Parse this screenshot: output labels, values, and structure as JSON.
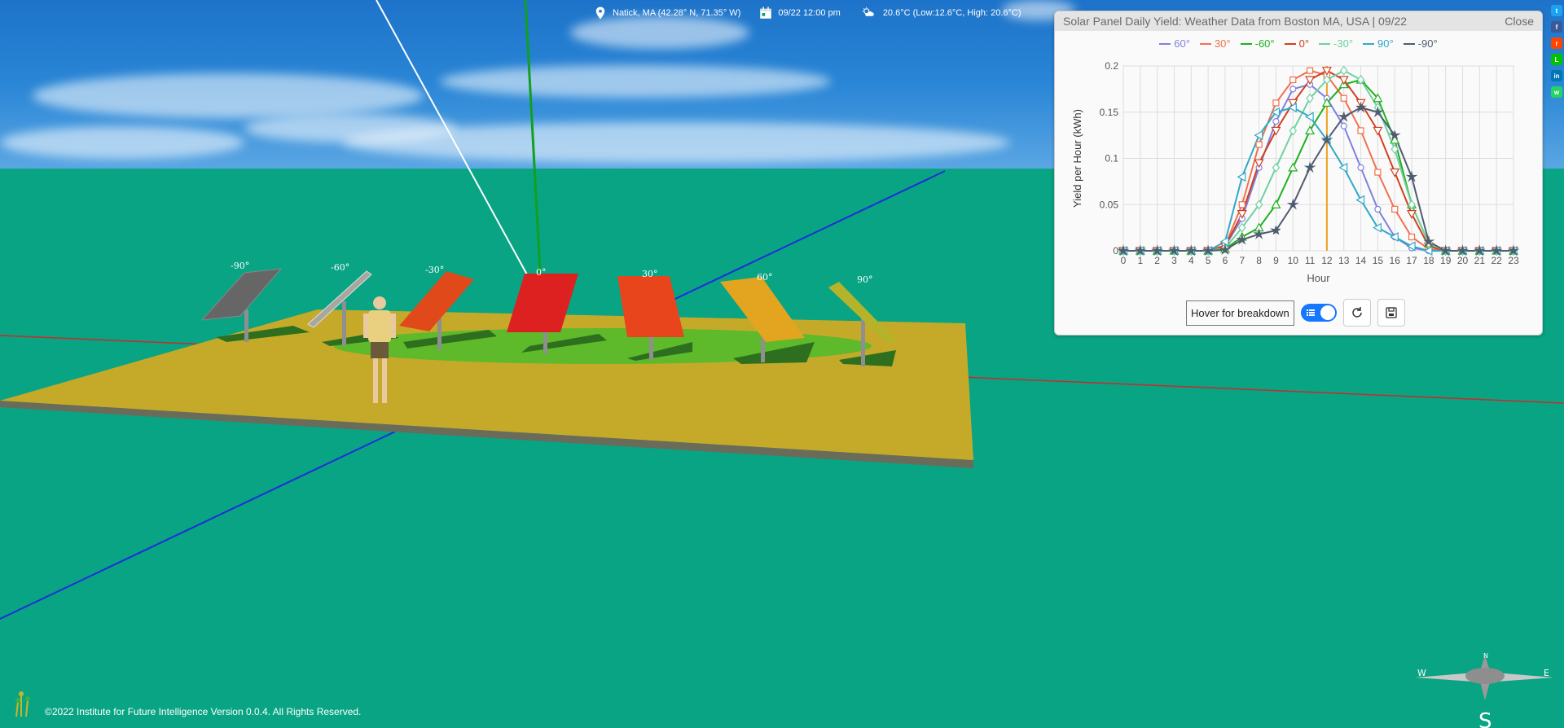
{
  "infobar": {
    "location": "Natick, MA (42.28° N, 71.35° W)",
    "datetime": "09/22 12:00 pm",
    "weather": "20.6°C (Low:12.6°C, High: 20.6°C)"
  },
  "scene": {
    "panel_labels": [
      "-90°",
      "-60°",
      "-30°",
      "0°",
      "30°",
      "60°",
      "90°"
    ]
  },
  "chart_window": {
    "title": "Solar Panel Daily Yield: Weather Data from Boston MA, USA | 09/22",
    "close_label": "Close",
    "hover_label": "Hover for breakdown"
  },
  "chart_data": {
    "type": "line",
    "xlabel": "Hour",
    "ylabel": "Yield per Hour (kWh)",
    "x": [
      0,
      1,
      2,
      3,
      4,
      5,
      6,
      7,
      8,
      9,
      10,
      11,
      12,
      13,
      14,
      15,
      16,
      17,
      18,
      19,
      20,
      21,
      22,
      23
    ],
    "ylim": [
      0,
      0.2
    ],
    "yticks": [
      "0",
      "0.05",
      "0.1",
      "0.15",
      "0.2"
    ],
    "xticks": [
      "0",
      "1",
      "2",
      "3",
      "4",
      "5",
      "6",
      "7",
      "8",
      "9",
      "10",
      "11",
      "12",
      "13",
      "14",
      "15",
      "16",
      "17",
      "18",
      "19",
      "20",
      "21",
      "22",
      "23"
    ],
    "current_hour": 12,
    "grid": true,
    "legend": "top",
    "series": [
      {
        "name": "60°",
        "color": "#8080e0",
        "marker": "circle",
        "values": [
          0,
          0,
          0,
          0,
          0,
          0,
          0.005,
          0.035,
          0.09,
          0.14,
          0.175,
          0.18,
          0.165,
          0.135,
          0.09,
          0.045,
          0.015,
          0.003,
          0,
          0,
          0,
          0,
          0,
          0
        ]
      },
      {
        "name": "30°",
        "color": "#f07050",
        "marker": "square",
        "values": [
          0,
          0,
          0,
          0,
          0,
          0,
          0.006,
          0.05,
          0.115,
          0.16,
          0.185,
          0.195,
          0.19,
          0.165,
          0.13,
          0.085,
          0.045,
          0.015,
          0.002,
          0,
          0,
          0,
          0,
          0
        ]
      },
      {
        "name": "-60°",
        "color": "#20b020",
        "marker": "triangle-up",
        "values": [
          0,
          0,
          0,
          0,
          0,
          0,
          0.002,
          0.015,
          0.025,
          0.05,
          0.09,
          0.13,
          0.16,
          0.18,
          0.185,
          0.165,
          0.12,
          0.05,
          0.008,
          0,
          0,
          0,
          0,
          0
        ]
      },
      {
        "name": "0°",
        "color": "#d04020",
        "marker": "triangle-down",
        "values": [
          0,
          0,
          0,
          0,
          0,
          0,
          0.005,
          0.04,
          0.095,
          0.13,
          0.16,
          0.185,
          0.195,
          0.185,
          0.16,
          0.13,
          0.085,
          0.04,
          0.005,
          0,
          0,
          0,
          0,
          0
        ]
      },
      {
        "name": "-30°",
        "color": "#70d0a0",
        "marker": "diamond",
        "values": [
          0,
          0,
          0,
          0,
          0,
          0,
          0.003,
          0.025,
          0.05,
          0.09,
          0.13,
          0.165,
          0.185,
          0.195,
          0.185,
          0.155,
          0.11,
          0.05,
          0.008,
          0,
          0,
          0,
          0,
          0
        ]
      },
      {
        "name": "90°",
        "color": "#30a8c8",
        "marker": "triangle-left",
        "values": [
          0,
          0,
          0,
          0,
          0,
          0,
          0.01,
          0.08,
          0.125,
          0.15,
          0.155,
          0.145,
          0.12,
          0.09,
          0.055,
          0.025,
          0.015,
          0.005,
          0,
          0,
          0,
          0,
          0,
          0
        ]
      },
      {
        "name": "-90°",
        "color": "#505c70",
        "marker": "star",
        "values": [
          0,
          0,
          0,
          0,
          0,
          0,
          0.001,
          0.012,
          0.018,
          0.022,
          0.05,
          0.09,
          0.12,
          0.145,
          0.155,
          0.15,
          0.125,
          0.08,
          0.01,
          0,
          0,
          0,
          0,
          0
        ]
      }
    ]
  },
  "share_icons": [
    {
      "label": "t",
      "color": "#1da1f2"
    },
    {
      "label": "f",
      "color": "#3b5998"
    },
    {
      "label": "r",
      "color": "#ff4500"
    },
    {
      "label": "L",
      "color": "#00c300"
    },
    {
      "label": "in",
      "color": "#0077b5"
    },
    {
      "label": "w",
      "color": "#25d366"
    }
  ],
  "footer": {
    "text": "©2022 Institute for Future Intelligence Version 0.0.4. All Rights Reserved."
  },
  "compass": {
    "n": "N",
    "s": "S",
    "e": "E",
    "w": "W"
  }
}
